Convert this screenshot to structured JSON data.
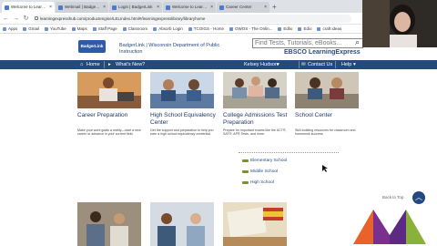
{
  "browser": {
    "tabs": [
      {
        "label": "Welcome to LearningExpress",
        "active": true
      },
      {
        "label": "Webmail | BadgerLink",
        "active": false
      },
      {
        "label": "Login | BadgerLink",
        "active": false
      },
      {
        "label": "Welcome to LearningExpress",
        "active": false
      },
      {
        "label": "Career Center",
        "active": false
      }
    ],
    "new_tab": "+",
    "url": "learningexpresshub.com/productengine/LELIndex.html#/learningexpresslibrary/libraryhome",
    "bookmarks": [
      "Apps",
      "Gmail",
      "YouTube",
      "Maps",
      "Staff Page",
      "Classroom",
      "Absorb Login",
      "TCOIGS - Home",
      "OWOS - The Onlin...",
      "Edlio",
      "Edio",
      "craft ideas"
    ]
  },
  "header": {
    "logo": "BadgerLink",
    "org_line1": "BadgerLink | Wisconsin Department of Public",
    "org_line2": "Instruction",
    "search_placeholder": "Find Tests, Tutorials, eBooks...",
    "ebsco": "EBSCO LearningExpress"
  },
  "nav": {
    "home": "Home",
    "whats_new": "What's New?",
    "user": "Kelsey Hudson",
    "contact": "Contact Us",
    "help": "Help"
  },
  "cards": [
    {
      "title": "Career Preparation",
      "desc": "Make your work goals a reality—start a new career or advance in your current field."
    },
    {
      "title": "High School Equivalency Center",
      "desc": "Get the support and preparation to help you earn a high school equivalency credential."
    },
    {
      "title": "College Admissions Test Preparation",
      "desc": "Prepare for important exams like the ACT®, SAT®, AP® Tests, and more."
    },
    {
      "title": "School Center",
      "desc": "Skill-building resources for classroom and homework success."
    }
  ],
  "school_submenu": [
    "Elementary School",
    "Middle School",
    "High School"
  ],
  "back_to_top": "Back to Top",
  "colors": {
    "nav_bar": "#23497e",
    "title_blue": "#1f3a68",
    "accent_green": "#7d8f2f",
    "accent_purple": "#7b2f8e"
  }
}
